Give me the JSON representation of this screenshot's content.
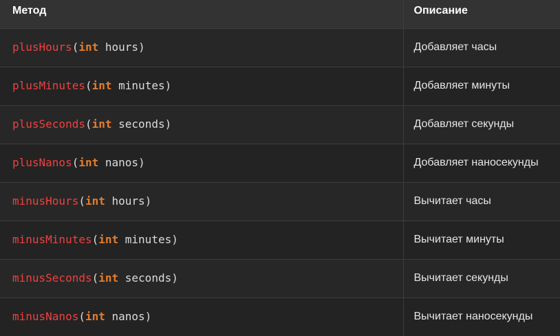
{
  "table": {
    "headers": {
      "method": "Метод",
      "description": "Описание"
    },
    "open_paren": "(",
    "close_paren": ")",
    "rows": [
      {
        "name": "plusHours",
        "type": "int",
        "param": "hours",
        "description": "Добавляет часы"
      },
      {
        "name": "plusMinutes",
        "type": "int",
        "param": "minutes",
        "description": "Добавляет минуты"
      },
      {
        "name": "plusSeconds",
        "type": "int",
        "param": "seconds",
        "description": "Добавляет секунды"
      },
      {
        "name": "plusNanos",
        "type": "int",
        "param": "nanos",
        "description": "Добавляет наносекунды"
      },
      {
        "name": "minusHours",
        "type": "int",
        "param": "hours",
        "description": "Вычитает часы"
      },
      {
        "name": "minusMinutes",
        "type": "int",
        "param": "minutes",
        "description": "Вычитает минуты"
      },
      {
        "name": "minusSeconds",
        "type": "int",
        "param": "seconds",
        "description": "Вычитает секунды"
      },
      {
        "name": "minusNanos",
        "type": "int",
        "param": "nanos",
        "description": "Вычитает наносекунды"
      }
    ]
  },
  "colors": {
    "method_name": "#ef4141",
    "keyword": "#e57d2e",
    "header_background": "#333333",
    "row_background": "#272727",
    "text": "#e6e6e6"
  }
}
